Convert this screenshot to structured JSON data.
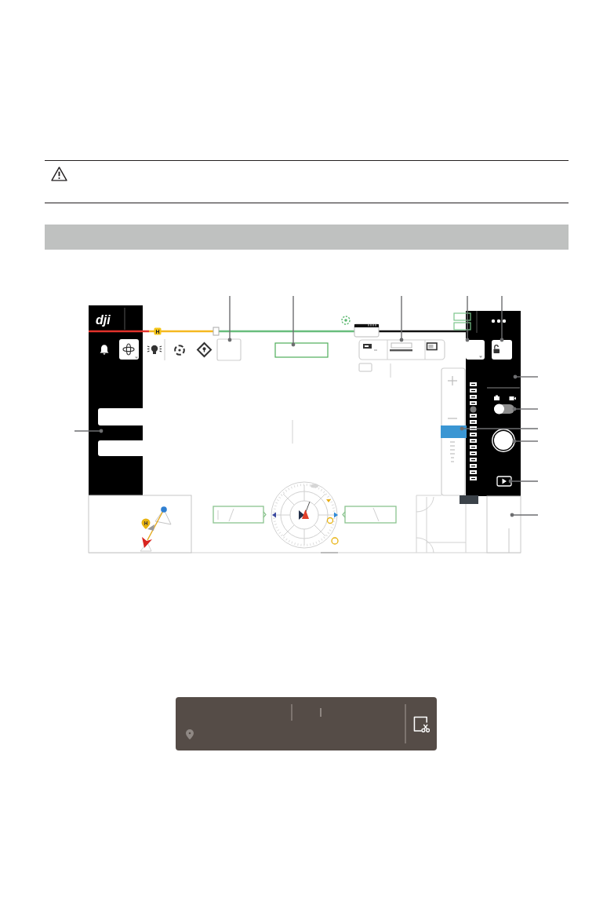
{
  "screen": {
    "logo": "dji",
    "home_marker": "H",
    "mode_switch": {
      "on": false
    },
    "zoom_slider": {
      "level": 0.5
    },
    "mini_map": {
      "home_pin": "H"
    }
  }
}
